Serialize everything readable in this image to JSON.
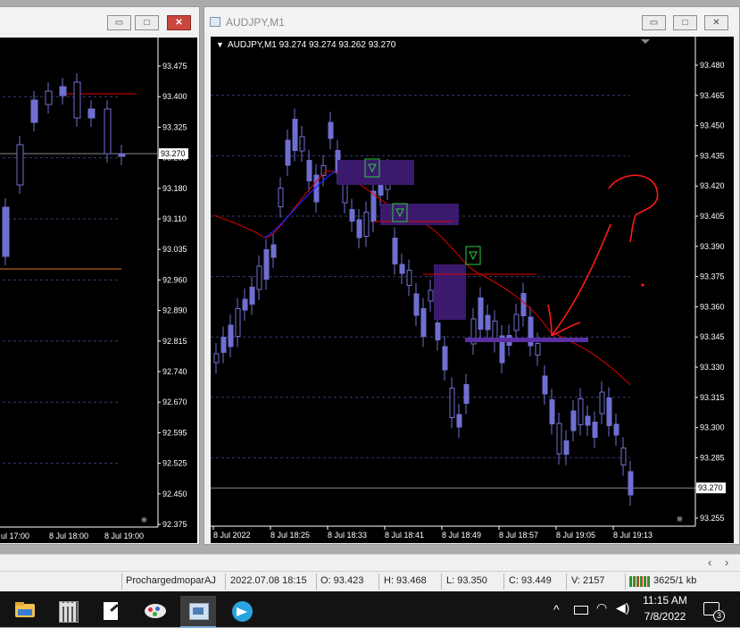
{
  "left_window": {
    "price_axis": [
      "93.475",
      "93.400",
      "93.325",
      "93.255",
      "93.180",
      "93.110",
      "93.035",
      "92.960",
      "92.890",
      "92.815",
      "92.740",
      "92.670",
      "92.595",
      "92.525",
      "92.450",
      "92.375"
    ],
    "current_price": "93.270",
    "time_labels": [
      "ul 17:00",
      "8 Jul 18:00",
      "8 Jul 19:00"
    ]
  },
  "right_window": {
    "title": "AUDJPY,M1",
    "chart_header": "AUDJPY,M1  93.274 93.274 93.262 93.270",
    "price_axis": [
      "93.480",
      "93.465",
      "93.450",
      "93.435",
      "93.420",
      "93.405",
      "93.390",
      "93.375",
      "93.360",
      "93.345",
      "93.330",
      "93.315",
      "93.300",
      "93.285",
      "93.270",
      "93.255"
    ],
    "current_price": "93.270",
    "time_labels": [
      "8 Jul 2022",
      "8 Jul 18:25",
      "8 Jul 18:33",
      "8 Jul 18:41",
      "8 Jul 18:49",
      "8 Jul 18:57",
      "8 Jul 19:05",
      "8 Jul 19:13"
    ]
  },
  "window_buttons": {
    "minimize": "▭",
    "maximize": "□",
    "close": "✕"
  },
  "scroll": {
    "left": "‹",
    "right": "›"
  },
  "status": {
    "profile": "ProchargedmoparAJ",
    "datetime": "2022.07.08 18:15",
    "open": "O: 93.423",
    "high": "H: 93.468",
    "low": "L: 93.350",
    "close": "C: 93.449",
    "volume": "V: 2157",
    "traffic": "3625/1 kb"
  },
  "taskbar": {
    "time": "11:15 AM",
    "date": "7/8/2022",
    "notification_count": "3",
    "apps": [
      "file-explorer",
      "calculator",
      "notepad",
      "paint",
      "metatrader",
      "telegram"
    ]
  },
  "colors": {
    "chart_bg": "#000000",
    "candle": "#6f6fd1",
    "moving_average": "#e00000",
    "zone": "#3b1a6e",
    "annotation": "#ff1a1a"
  }
}
